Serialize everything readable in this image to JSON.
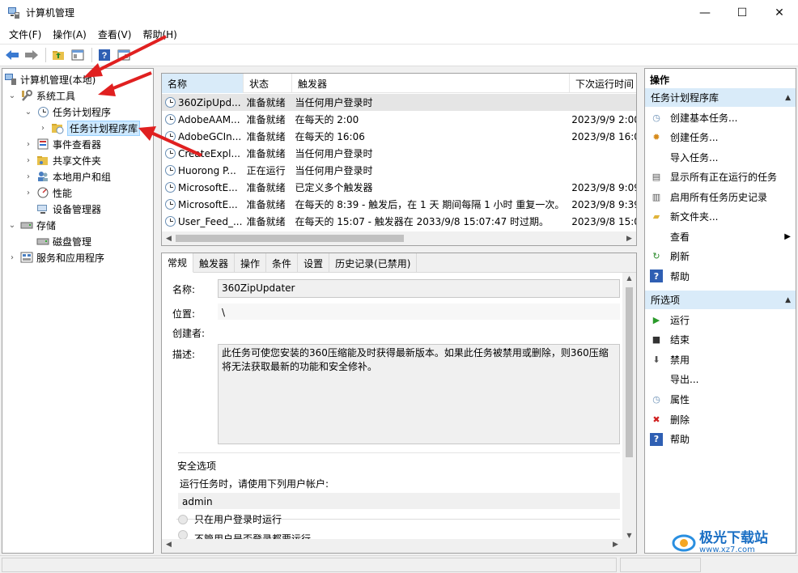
{
  "window": {
    "title": "计算机管理",
    "minimize": "—",
    "maximize": "☐",
    "close": "✕"
  },
  "menu": [
    "文件(F)",
    "操作(A)",
    "查看(V)",
    "帮助(H)"
  ],
  "tree": {
    "root": "计算机管理(本地)",
    "system_tools": "系统工具",
    "task_scheduler": "任务计划程序",
    "task_library": "任务计划程序库",
    "event_viewer": "事件查看器",
    "shared_folders": "共享文件夹",
    "local_users": "本地用户和组",
    "performance": "性能",
    "device_manager": "设备管理器",
    "storage": "存储",
    "disk_management": "磁盘管理",
    "services_apps": "服务和应用程序"
  },
  "task_list": {
    "columns": [
      "名称",
      "状态",
      "触发器",
      "下次运行时间"
    ],
    "rows": [
      {
        "name": "360ZipUpd...",
        "status": "准备就绪",
        "trigger": "当任何用户登录时",
        "next": ""
      },
      {
        "name": "AdobeAAM...",
        "status": "准备就绪",
        "trigger": "在每天的 2:00",
        "next": "2023/9/9 2:00"
      },
      {
        "name": "AdobeGCIn...",
        "status": "准备就绪",
        "trigger": "在每天的 16:06",
        "next": "2023/9/8 16:0"
      },
      {
        "name": "CreateExpl...",
        "status": "准备就绪",
        "trigger": "当任何用户登录时",
        "next": ""
      },
      {
        "name": "Huorong P...",
        "status": "正在运行",
        "trigger": "当任何用户登录时",
        "next": ""
      },
      {
        "name": "MicrosoftE...",
        "status": "准备就绪",
        "trigger": "已定义多个触发器",
        "next": "2023/9/8 9:09"
      },
      {
        "name": "MicrosoftE...",
        "status": "准备就绪",
        "trigger": "在每天的 8:39 - 触发后，在 1 天 期间每隔 1 小时 重复一次。",
        "next": "2023/9/8 9:39"
      },
      {
        "name": "User_Feed_...",
        "status": "准备就绪",
        "trigger": "在每天的 15:07 - 触发器在 2033/9/8 15:07:47 时过期。",
        "next": "2023/9/8 15:0"
      }
    ]
  },
  "detail": {
    "tabs": [
      "常规",
      "触发器",
      "操作",
      "条件",
      "设置",
      "历史记录(已禁用)"
    ],
    "name_label": "名称:",
    "name_value": "360ZipUpdater",
    "location_label": "位置:",
    "location_value": "\\",
    "author_label": "创建者:",
    "desc_label": "描述:",
    "desc_value": "此任务可使您安装的360压缩能及时获得最新版本。如果此任务被禁用或删除，则360压缩将无法获取最新的功能和安全修补。",
    "security_title": "安全选项",
    "run_as_label": "运行任务时，请使用下列用户帐户:",
    "run_as_value": "admin",
    "radio1": "只在用户登录时运行",
    "radio2": "不管用户是否登录都要运行"
  },
  "actions": {
    "header": "操作",
    "section1": "任务计划程序库",
    "items1": [
      "创建基本任务...",
      "创建任务...",
      "导入任务...",
      "显示所有正在运行的任务",
      "启用所有任务历史记录",
      "新文件夹...",
      "查看",
      "刷新",
      "帮助"
    ],
    "section2": "所选项",
    "items2": [
      "运行",
      "结束",
      "禁用",
      "导出...",
      "属性",
      "删除",
      "帮助"
    ]
  },
  "watermark": {
    "line1": "极光下载站",
    "line2": "www.xz7.com"
  }
}
